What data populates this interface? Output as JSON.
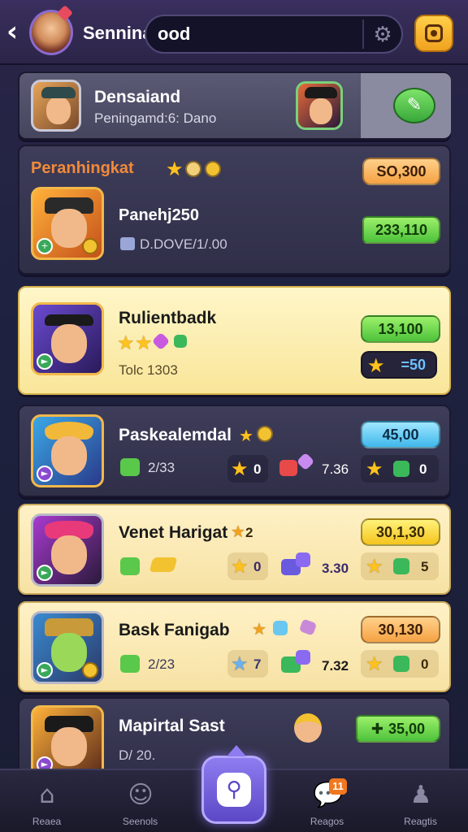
{
  "header": {
    "title": "Sennina",
    "search_value": "ood",
    "icons": {
      "back": "chevron-left-icon",
      "settings": "gear-icon",
      "camera": "camera-icon"
    }
  },
  "top_card": {
    "name": "Densaiand",
    "subtitle": "Peningamd:6: Dano",
    "action_icon": "edit-icon"
  },
  "players": [
    {
      "name": "Peranhingkat",
      "player": "Panehj250",
      "detail": "D.DOVE/1/.00",
      "score": "SO,300",
      "value": "233,110"
    },
    {
      "name": "Rulientbadk",
      "detail": "Tolc 1303",
      "score": "13,100",
      "stars_value": "=50"
    },
    {
      "name": "Paskealemdal",
      "score": "45,00",
      "stat1": "2/33",
      "stat2": "0",
      "stat3": "7.36",
      "stat4": "0"
    },
    {
      "name": "Venet Harigat",
      "tag": "2",
      "score": "30,1,30",
      "stat2": "0",
      "stat3": "3.30",
      "stat4": "5"
    },
    {
      "name": "Bask Fanigab",
      "score": "30,130",
      "stat1": "2/23",
      "stat2": "7",
      "stat3": "7.32",
      "stat4": "0"
    },
    {
      "name": "Mapirtal Sast",
      "detail": "D/ 20.",
      "score": "35,00"
    }
  ],
  "bottom_nav": {
    "items": [
      {
        "label": "Reaea",
        "icon": "home-icon"
      },
      {
        "label": "Seenols",
        "icon": "profile-icon"
      },
      {
        "label": "",
        "icon": "search-icon"
      },
      {
        "label": "Reagos",
        "icon": "chat-icon",
        "badge": "11"
      },
      {
        "label": "Reagtis",
        "icon": "user-icon"
      }
    ]
  },
  "colors": {
    "background": "#1e2240",
    "accent_purple": "#5c48c6",
    "gold": "#f2c230",
    "green": "#4dc23b",
    "orange": "#f5a243"
  }
}
